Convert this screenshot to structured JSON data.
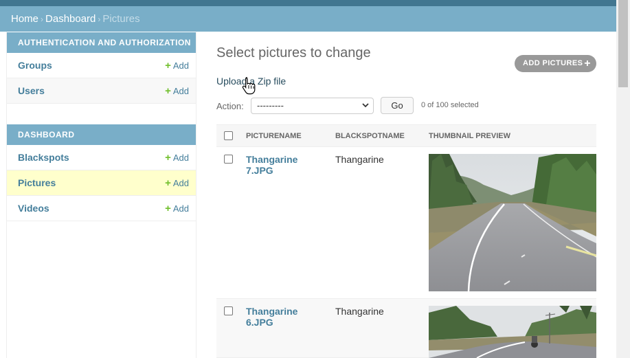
{
  "breadcrumbs": {
    "home": "Home",
    "dashboard": "Dashboard",
    "current": "Pictures",
    "separator": "›"
  },
  "sidebar": {
    "modules": [
      {
        "caption": "Authentication and Authorization",
        "items": [
          {
            "label": "Groups",
            "add": "Add"
          },
          {
            "label": "Users",
            "add": "Add"
          }
        ]
      },
      {
        "caption": "Dashboard",
        "items": [
          {
            "label": "Blackspots",
            "add": "Add"
          },
          {
            "label": "Pictures",
            "add": "Add",
            "selected": true
          },
          {
            "label": "Videos",
            "add": "Add"
          }
        ]
      }
    ]
  },
  "main": {
    "title": "Select pictures to change",
    "add_button": "Add Pictures",
    "upload_link": "Upload a Zip file",
    "action_label": "Action:",
    "action_value": "---------",
    "go_button": "Go",
    "selected_count": "0 of 100 selected",
    "columns": [
      "Picturename",
      "Blackspotname",
      "Thumbnail Preview"
    ],
    "rows": [
      {
        "picturename": "Thangarine 7.JPG",
        "blackspotname": "Thangarine"
      },
      {
        "picturename": "Thangarine 6.JPG",
        "blackspotname": "Thangarine"
      }
    ]
  },
  "colors": {
    "header": "#79aec8",
    "topbar": "#417690",
    "link": "#447e9b",
    "add_green": "#70bf2b",
    "selected_row": "#ffffcc"
  },
  "icons": [
    "plus-icon",
    "hand-pointer-icon",
    "chevron-down-icon"
  ]
}
